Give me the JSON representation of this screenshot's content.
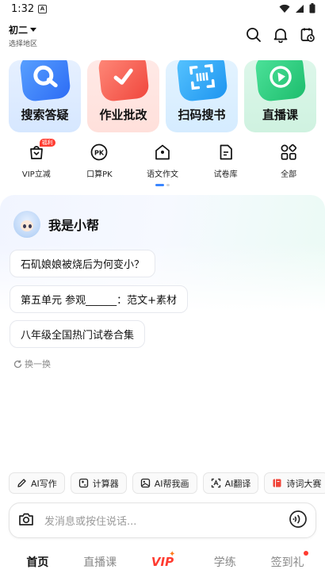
{
  "status": {
    "time": "1:32",
    "notification_icon": "a-icon",
    "right_icons": [
      "wifi-icon",
      "cell-signal-icon",
      "battery-icon"
    ]
  },
  "header": {
    "grade": "初二",
    "region": "选择地区",
    "icons": [
      "search-icon",
      "bell-icon",
      "history-icon"
    ]
  },
  "features": [
    {
      "label": "搜索答疑",
      "icon": "search-q-icon",
      "color": "#2d6cf5"
    },
    {
      "label": "作业批改",
      "icon": "check-icon",
      "color": "#f0473d"
    },
    {
      "label": "扫码搜书",
      "icon": "scan-icon",
      "color": "#1e95f0"
    },
    {
      "label": "直播课",
      "icon": "live-play-icon",
      "color": "#1dbd6d"
    }
  ],
  "shortcuts": [
    {
      "label": "VIP立减",
      "icon": "vip-bag-icon",
      "badge": "福利"
    },
    {
      "label": "口算PK",
      "icon": "pk-icon",
      "badge": ""
    },
    {
      "label": "语文作文",
      "icon": "pentagon-icon",
      "badge": ""
    },
    {
      "label": "试卷库",
      "icon": "paper-icon",
      "badge": ""
    },
    {
      "label": "全部",
      "icon": "grid-icon",
      "badge": ""
    }
  ],
  "assistant": {
    "name": "我是小帮",
    "suggestions": [
      "石矶娘娘被烧后为何变小？",
      "第五单元 参观______：范文+素材",
      "八年级全国热门试卷合集"
    ],
    "refresh_label": "换一换"
  },
  "tools": [
    {
      "label": "AI写作",
      "icon": "pen-icon"
    },
    {
      "label": "计算器",
      "icon": "calculator-icon"
    },
    {
      "label": "AI帮我画",
      "icon": "image-icon"
    },
    {
      "label": "AI翻译",
      "icon": "translate-icon"
    },
    {
      "label": "诗词大赛",
      "icon": "book-icon"
    }
  ],
  "input": {
    "placeholder": "发消息或按住说话..."
  },
  "nav": {
    "items": [
      "首页",
      "直播课",
      "VIP",
      "学练",
      "签到礼"
    ],
    "active": "首页"
  },
  "colors": {
    "accent": "#3a86ff",
    "vip": "#ff3b30"
  }
}
